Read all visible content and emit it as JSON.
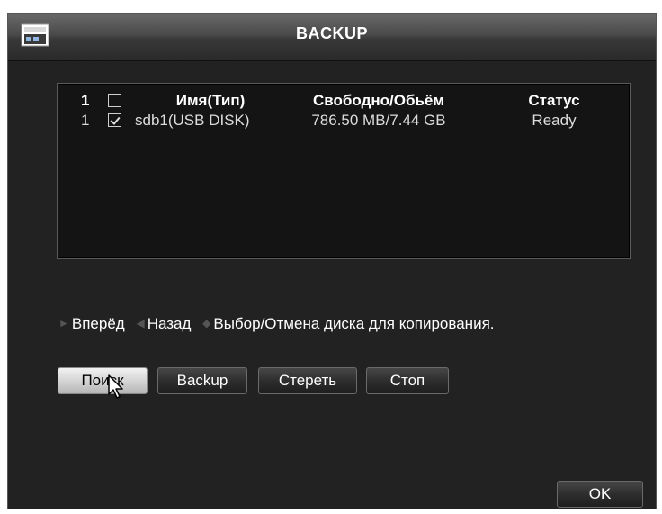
{
  "dialog": {
    "title": "BACKUP",
    "icon": "backup-device-icon"
  },
  "table": {
    "header": {
      "index": "1",
      "name": "Имя(Тип)",
      "space": "Свободно/Обьём",
      "status": "Статус"
    },
    "rows": [
      {
        "index": "1",
        "checked": true,
        "name": "sdb1(USB DISK)",
        "space": "786.50 MB/7.44 GB",
        "status": "Ready"
      }
    ]
  },
  "legend": {
    "forward": "Вперёд",
    "back": "Назад",
    "select": "Выбор/Отмена диска для копирования."
  },
  "buttons": {
    "search": "Поиск",
    "backup": "Backup",
    "erase": "Стереть",
    "stop": "Стоп",
    "ok": "OK"
  },
  "icons": [
    "backup-device-icon",
    "checkbox-icon",
    "arrow-icon",
    "mouse-cursor-icon"
  ]
}
